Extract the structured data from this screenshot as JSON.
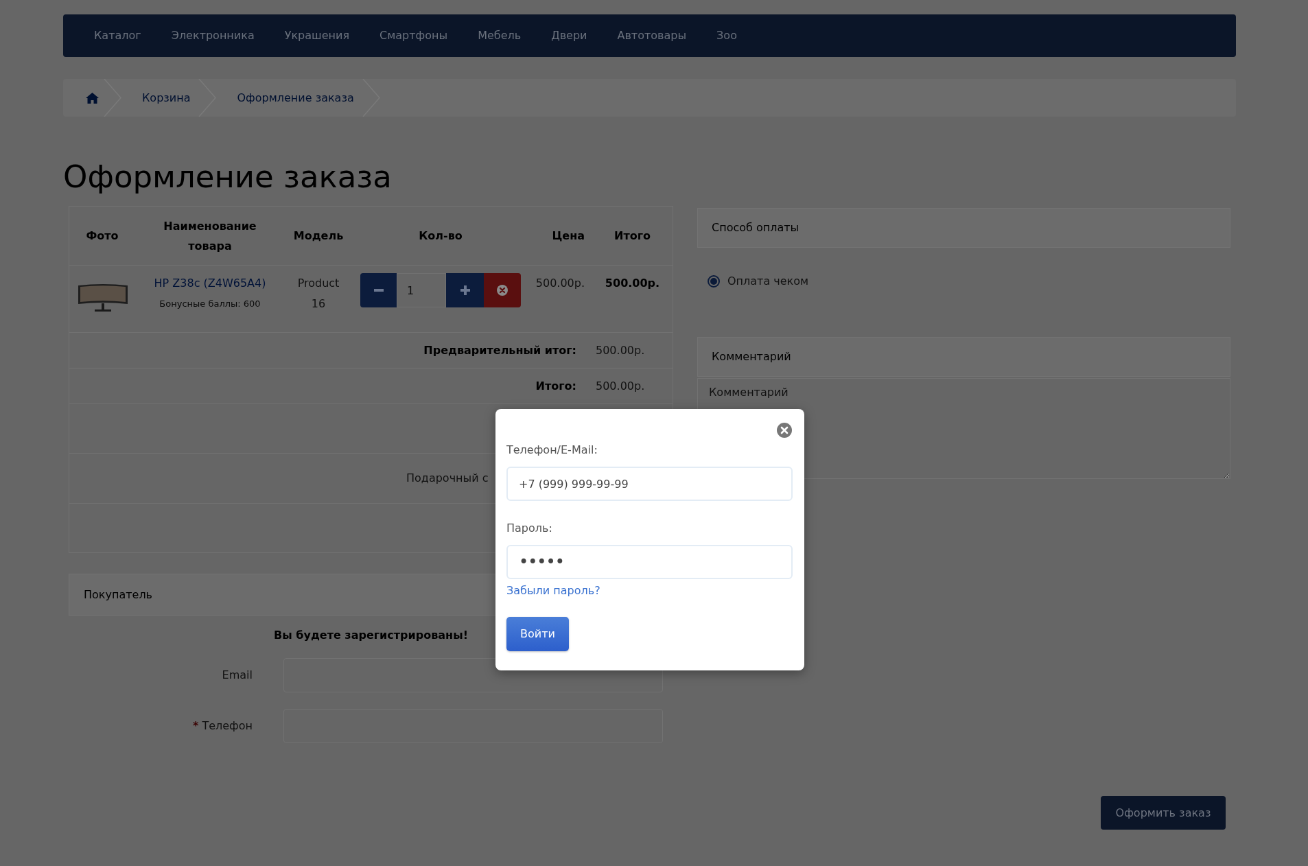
{
  "nav": {
    "items": [
      "Каталог",
      "Электронника",
      "Украшения",
      "Смартфоны",
      "Мебель",
      "Двери",
      "Автотовары",
      "Зоо"
    ]
  },
  "breadcrumb": [
    {
      "kind": "home"
    },
    {
      "kind": "link",
      "label": "Корзина"
    },
    {
      "kind": "link",
      "label": "Оформление заказа"
    }
  ],
  "page_title": "Оформление заказа",
  "cart": {
    "columns": [
      "Фото",
      "Наименование товара",
      "Модель",
      "Кол-во",
      "Цена",
      "Итого"
    ],
    "items": [
      {
        "name": "HP Z38c (Z4W65A4)",
        "bonus": "Бонусные баллы: 600",
        "model": "Product 16",
        "quantity": "1",
        "price": "500.00р.",
        "total": "500.00р."
      }
    ],
    "totals": [
      {
        "label": "Предварительный итог:",
        "value": "500.00р."
      },
      {
        "label": "Итого:",
        "value": "500.00р."
      }
    ],
    "gift_certificate_row": "Подарочный с"
  },
  "customer": {
    "title": "Покупатель",
    "notice": "Вы будете зарегистрированы!",
    "fields": [
      {
        "label": "Email"
      },
      {
        "label": "Телефон",
        "required_mark": "*"
      }
    ]
  },
  "payment": {
    "title": "Способ оплаты",
    "options": [
      {
        "label": "Оплата чеком",
        "selected": true
      }
    ]
  },
  "comment": {
    "title": "Комментарий",
    "placeholder": "Комментарий"
  },
  "submit_button": "Оформить заказ",
  "login_modal": {
    "fields": [
      {
        "kind": "text",
        "label": "Телефон/E-Mail:",
        "value": "+7 (999) 999-99-99"
      },
      {
        "kind": "password",
        "label": "Пароль:",
        "value": "•••••"
      }
    ],
    "forgot_link": "Забыли пароль?",
    "submit": "Войти"
  }
}
